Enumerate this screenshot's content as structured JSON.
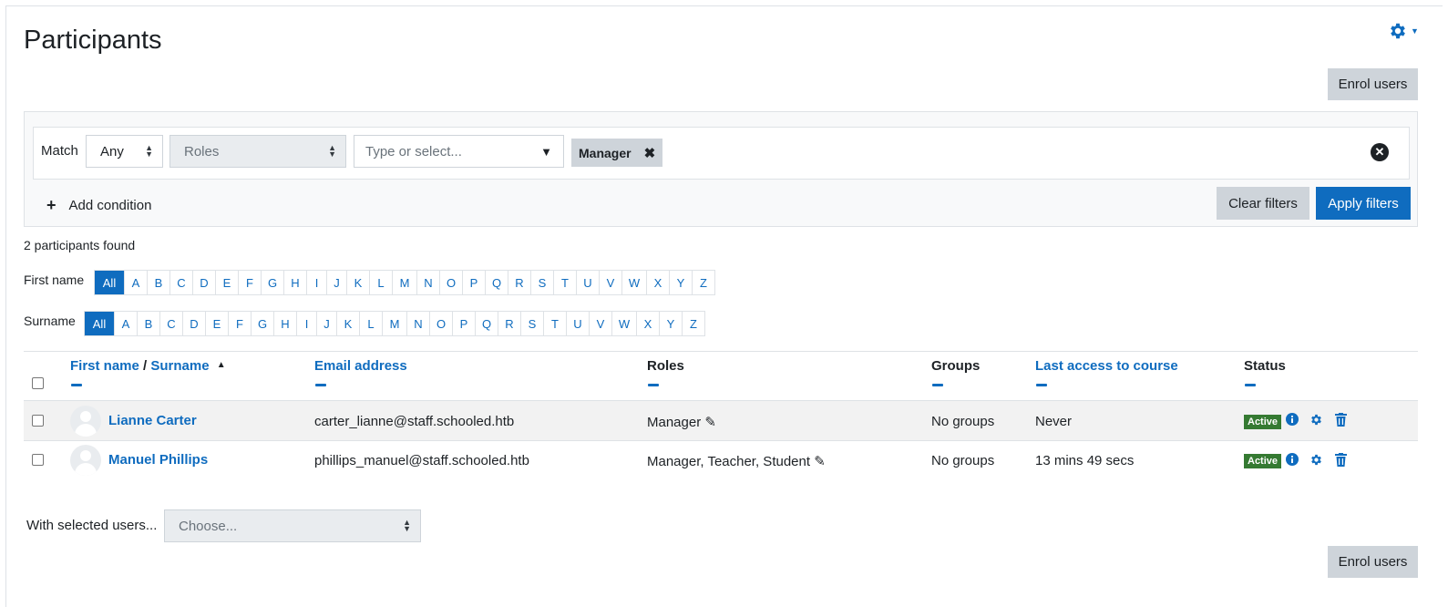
{
  "page": {
    "title": "Participants"
  },
  "actions": {
    "enrol_label": "Enrol users"
  },
  "filter": {
    "match_label": "Match",
    "match_value": "Any",
    "field_value": "Roles",
    "type_placeholder": "Type or select...",
    "selected_pill": "Manager",
    "add_condition": "Add condition",
    "clear_label": "Clear filters",
    "apply_label": "Apply filters"
  },
  "summary": {
    "found": "2 participants found"
  },
  "initials": {
    "firstname_label": "First name",
    "surname_label": "Surname",
    "all": "All",
    "letters": [
      "A",
      "B",
      "C",
      "D",
      "E",
      "F",
      "G",
      "H",
      "I",
      "J",
      "K",
      "L",
      "M",
      "N",
      "O",
      "P",
      "Q",
      "R",
      "S",
      "T",
      "U",
      "V",
      "W",
      "X",
      "Y",
      "Z"
    ]
  },
  "table": {
    "headers": {
      "firstname": "First name",
      "sep": "/",
      "surname": "Surname",
      "email": "Email address",
      "roles": "Roles",
      "groups": "Groups",
      "last_access": "Last access to course",
      "status": "Status"
    },
    "rows": [
      {
        "name": "Lianne Carter",
        "email": "carter_lianne@staff.schooled.htb",
        "roles": "Manager",
        "groups": "No groups",
        "last_access": "Never",
        "status": "Active"
      },
      {
        "name": "Manuel Phillips",
        "email": "phillips_manuel@staff.schooled.htb",
        "roles": "Manager, Teacher, Student",
        "groups": "No groups",
        "last_access": "13 mins 49 secs",
        "status": "Active"
      }
    ]
  },
  "bulk": {
    "label": "With selected users...",
    "placeholder": "Choose..."
  },
  "colors": {
    "primary": "#0f6cbf",
    "success": "#357a32",
    "secondary": "#ced4da"
  }
}
